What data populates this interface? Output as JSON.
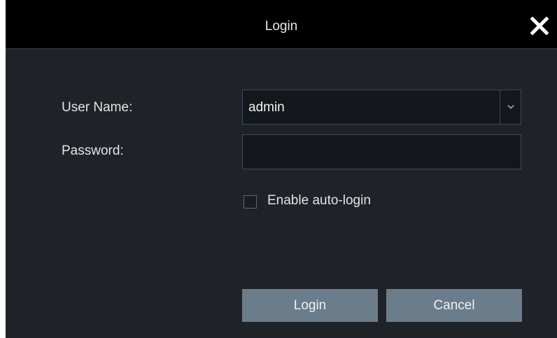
{
  "dialog": {
    "title": "Login"
  },
  "form": {
    "username_label": "User Name:",
    "username_value": "admin",
    "password_label": "Password:",
    "password_value": "",
    "auto_login_label": "Enable auto-login",
    "auto_login_checked": false
  },
  "buttons": {
    "login_label": "Login",
    "cancel_label": "Cancel"
  },
  "icons": {
    "close": "close-icon",
    "dropdown": "chevron-down-icon"
  },
  "colors": {
    "background": "#1f2328",
    "titlebar": "#000000",
    "field_border": "#3e4c5c",
    "button": "#6b7c8b"
  }
}
